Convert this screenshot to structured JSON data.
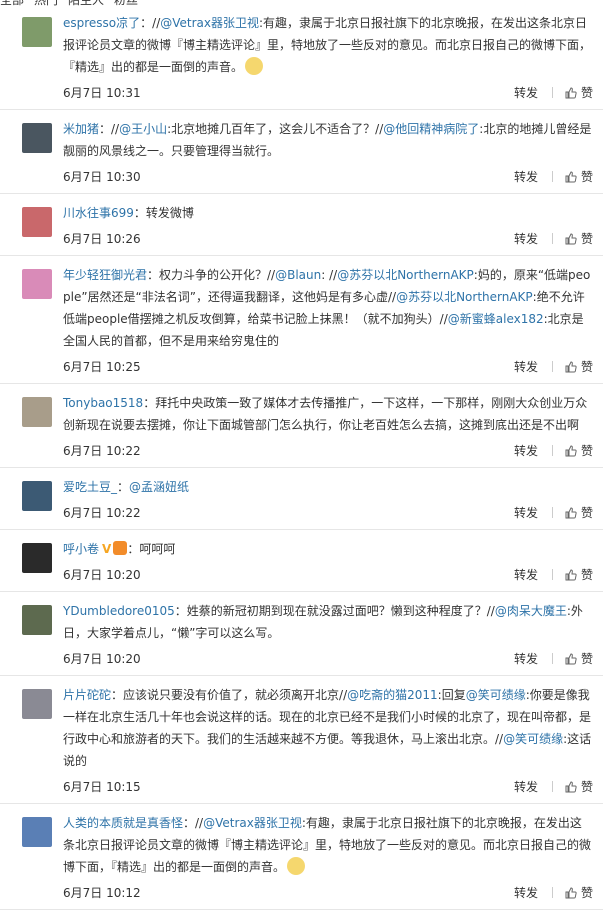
{
  "header": {
    "tabs": [
      "全部",
      "热门",
      "陌生人",
      "粉丝"
    ]
  },
  "actions": {
    "forward": "转发",
    "like": "赞"
  },
  "comments": [
    {
      "name": "espresso凉了",
      "segments": [
        {
          "t": "：//"
        },
        {
          "t": "@Vetrax器张卫视",
          "at": true
        },
        {
          "t": ":有趣，隶属于北京日报社旗下的北京晚报，在发出这条北京日报评论员文章的微博『博主精选评论』里，特地放了一些反对的意见。而北京日报自己的微博下面，『精选』出的都是一面倒的声音。"
        }
      ],
      "emoji": "glasses-emoji",
      "time": "6月7日 10:31",
      "avatar_color": "#7f9b6a"
    },
    {
      "name": "米加猪",
      "segments": [
        {
          "t": "：//"
        },
        {
          "t": "@王小山",
          "at": true
        },
        {
          "t": ":北京地摊几百年了，这会儿不适合了？//"
        },
        {
          "t": "@他回精神病院了",
          "at": true
        },
        {
          "t": ":北京的地摊儿曾经是靓丽的风景线之一。只要管理得当就行。"
        }
      ],
      "time": "6月7日 10:30",
      "avatar_color": "#4a5660"
    },
    {
      "name": "川水往事699",
      "segments": [
        {
          "t": "：转发微博"
        }
      ],
      "time": "6月7日 10:26",
      "avatar_color": "#c9686b"
    },
    {
      "name": "年少轻狂御光君",
      "segments": [
        {
          "t": "：权力斗争的公开化？//"
        },
        {
          "t": "@Blaun",
          "at": true
        },
        {
          "t": ": //"
        },
        {
          "t": "@苏芬以北NorthernAKP",
          "at": true
        },
        {
          "t": ":妈的，原来“低端people”居然还是“非法名词”，还得逼我翻译，这他妈是有多心虚//"
        },
        {
          "t": "@苏芬以北NorthernAKP",
          "at": true
        },
        {
          "t": ":绝不允许低端people借摆摊之机反攻倒算，给菜书记脸上抹黑！（就不加狗头）//"
        },
        {
          "t": "@新蜜蜂alex182",
          "at": true
        },
        {
          "t": ":北京是全国人民的首都，但不是用来给穷鬼住的"
        }
      ],
      "time": "6月7日 10:25",
      "avatar_color": "#d98bb8"
    },
    {
      "name": "Tonybao1518",
      "segments": [
        {
          "t": "：拜托中央政策一致了媒体才去传播推广，一下这样，一下那样，刚刚大众创业万众创新现在说要去摆摊，你让下面城管部门怎么执行，你让老百姓怎么去搞，这摊到底出还是不出啊"
        }
      ],
      "time": "6月7日 10:22",
      "avatar_color": "#a89d8a"
    },
    {
      "name": "爱吃土豆_",
      "segments": [
        {
          "t": "："
        },
        {
          "t": "@孟涵妞纸",
          "at": true
        }
      ],
      "time": "6月7日 10:22",
      "avatar_color": "#3c5a74"
    },
    {
      "name": "呼小卷",
      "badge": "V",
      "segments": [
        {
          "t": "：呵呵呵"
        }
      ],
      "time": "6月7日 10:20",
      "avatar_color": "#2a2a2a"
    },
    {
      "name": "YDumbledore0105",
      "segments": [
        {
          "t": "：姓蔡的新冠初期到现在就没露过面吧？懒到这种程度了？//"
        },
        {
          "t": "@肉呆大魔王",
          "at": true
        },
        {
          "t": ":外日，大家学着点儿，“懒”字可以这么写。"
        }
      ],
      "time": "6月7日 10:20",
      "avatar_color": "#5d6a4f"
    },
    {
      "name": "片片砣砣",
      "segments": [
        {
          "t": "：应该说只要没有价值了，就必须离开北京"
        },
        {
          "t": "//"
        },
        {
          "t": "@吃斋的猫2011",
          "at": true
        },
        {
          "t": ":回复"
        },
        {
          "t": "@笑可绩缘",
          "at": true
        },
        {
          "t": ":你要是像我一样在北京生活几十年也会说这样的话。现在的北京已经不是我们小时候的北京了，现在叫帝都，是行政中心和旅游者的天下。我们的生活越来越不方便。等我退休，马上滚出北京。//"
        },
        {
          "t": "@笑可绩缘",
          "at": true
        },
        {
          "t": ":这话说的"
        }
      ],
      "time": "6月7日 10:15",
      "avatar_color": "#8a8a94"
    },
    {
      "name": "人类的本质就是真香怪",
      "segments": [
        {
          "t": "：//"
        },
        {
          "t": "@Vetrax器张卫视",
          "at": true
        },
        {
          "t": ":有趣，隶属于北京日报社旗下的北京晚报，在发出这条北京日报评论员文章的微博『博主精选评论』里，特地放了一些反对的意见。而北京日报自己的微博下面，『精选』出的都是一面倒的声音。"
        }
      ],
      "emoji": "glasses-emoji",
      "time": "6月7日 10:12",
      "avatar_color": "#5a7fb5"
    }
  ]
}
